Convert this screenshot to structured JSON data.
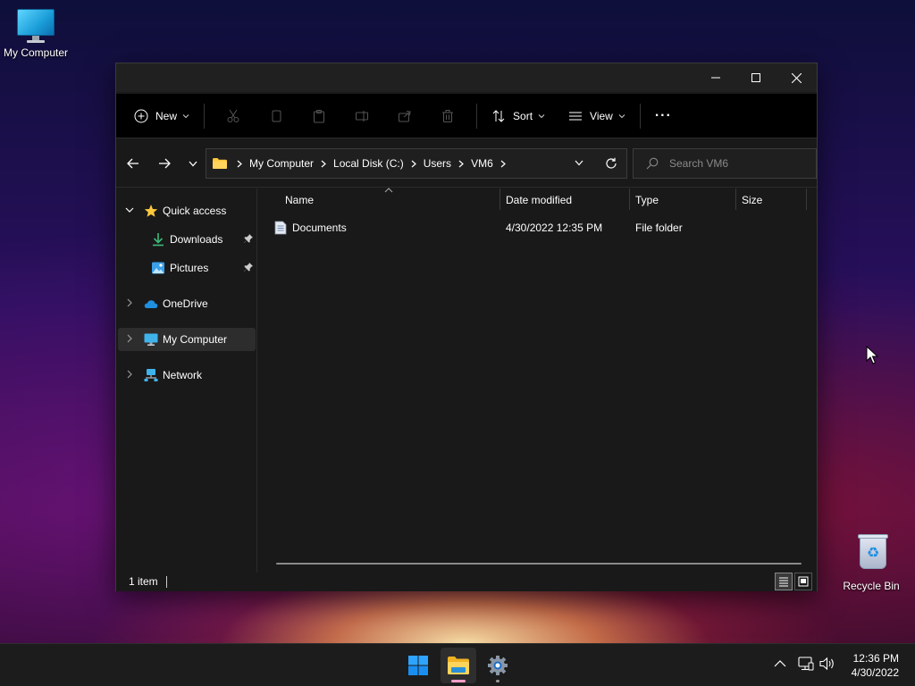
{
  "desktop": {
    "icons": {
      "my_computer": "My Computer",
      "recycle_bin": "Recycle Bin"
    }
  },
  "window": {
    "controls": {
      "minimize": "minimize",
      "maximize": "maximize",
      "close": "close"
    },
    "command_bar": {
      "new_label": "New",
      "sort_label": "Sort",
      "view_label": "View",
      "more_label": "···",
      "disabled_icons": [
        "cut-icon",
        "copy-icon",
        "paste-icon",
        "rename-icon",
        "share-icon",
        "delete-icon"
      ]
    },
    "address_bar": {
      "crumbs": [
        "My Computer",
        "Local Disk (C:)",
        "Users",
        "VM6"
      ]
    },
    "search": {
      "placeholder": "Search VM6"
    },
    "nav_pane": {
      "items": [
        {
          "label": "Quick access",
          "icon": "star-icon"
        },
        {
          "label": "Downloads",
          "icon": "download-icon",
          "pinned": true
        },
        {
          "label": "Pictures",
          "icon": "pictures-icon",
          "pinned": true
        },
        {
          "label": "OneDrive",
          "icon": "cloud-icon"
        },
        {
          "label": "My Computer",
          "icon": "computer-icon",
          "selected": true
        },
        {
          "label": "Network",
          "icon": "network-icon"
        }
      ]
    },
    "file_list": {
      "columns": [
        "Name",
        "Date modified",
        "Type",
        "Size"
      ],
      "rows": [
        {
          "name": "Documents",
          "date_modified": "4/30/2022 12:35 PM",
          "type": "File folder",
          "size": ""
        }
      ]
    },
    "status": {
      "item_count": "1 item"
    }
  },
  "taskbar": {
    "apps": [
      "start-icon",
      "file-explorer-icon",
      "settings-icon"
    ],
    "tray": [
      "chevron-up-icon",
      "network-icon",
      "volume-icon"
    ],
    "clock": {
      "time": "12:36 PM",
      "date": "4/30/2022"
    }
  },
  "colors": {
    "accent": "#0078d4",
    "folder_yellow": "#ffc83d",
    "window_bg": "#191919",
    "taskbar_bg": "#1c1c1c",
    "selected_bg": "#2d2d2d"
  }
}
